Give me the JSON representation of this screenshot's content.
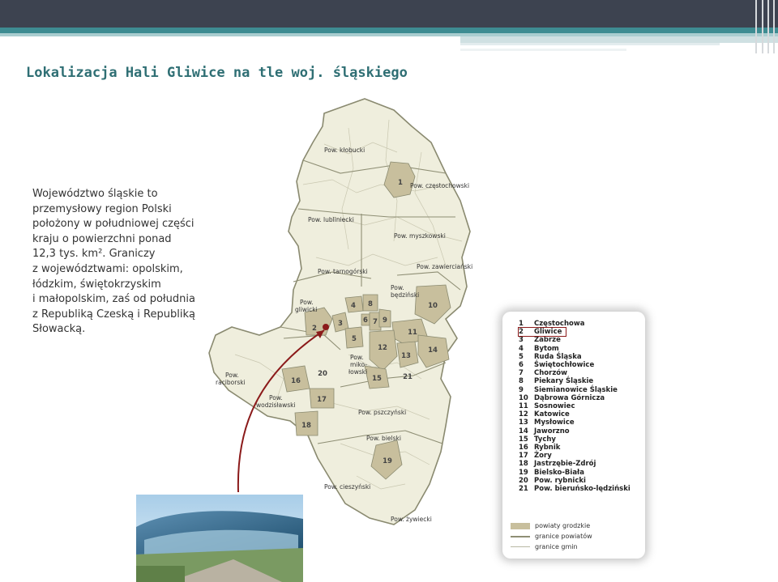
{
  "header": {
    "title": "Lokalizacja Hali Gliwice na tle woj. śląskiego"
  },
  "description_lines": [
    "Województwo śląskie to",
    "przemysłowy region Polski",
    "położony w południowej części",
    "kraju o powierzchni ponad",
    "12,3 tys. km². Graniczy",
    "z województwami: opolskim,",
    "łódzkim, świętokrzyskim",
    "i małopolskim, zaś od południa",
    "z Republiką Czeską i Republiką",
    "Słowacką."
  ],
  "map": {
    "powiat_labels": {
      "klobucki": "Pow. kłobucki",
      "czestochowski": "Pow. częstochowski",
      "lubliniecki": "Pow. lubliniecki",
      "myszkowski": "Pow. myszkowski",
      "zawiercianski": "Pow. zawierciański",
      "tarnogorski": "Pow. tarnogórski",
      "bedzinski_1": "Pow.",
      "bedzinski_2": "będziński",
      "gliwicki_1": "Pow.",
      "gliwicki_2": "gliwicki",
      "mikolowski_1": "Pow.",
      "mikolowski_2": "miko-",
      "mikolowski_3": "łowski",
      "raciborski_1": "Pow.",
      "raciborski_2": "raciborski",
      "wodzislawski_1": "Pow.",
      "wodzislawski_2": "wodzisławski",
      "pszczynski": "Pow. pszczyński",
      "bielski": "Pow. bielski",
      "cieszynski": "Pow. cieszyński",
      "zywiecki": "Pow. żywiecki"
    },
    "numbers": [
      "1",
      "2",
      "3",
      "4",
      "5",
      "6",
      "7",
      "8",
      "9",
      "10",
      "11",
      "12",
      "13",
      "14",
      "15",
      "16",
      "17",
      "18",
      "19",
      "20",
      "21"
    ]
  },
  "legend": {
    "items": [
      {
        "num": "1",
        "name": "Częstochowa"
      },
      {
        "num": "2",
        "name": "Gliwice"
      },
      {
        "num": "3",
        "name": "Zabrze"
      },
      {
        "num": "4",
        "name": "Bytom"
      },
      {
        "num": "5",
        "name": "Ruda Śląska"
      },
      {
        "num": "6",
        "name": "Świętochłowice"
      },
      {
        "num": "7",
        "name": "Chorzów"
      },
      {
        "num": "8",
        "name": "Piekary Śląskie"
      },
      {
        "num": "9",
        "name": "Siemianowice Śląskie"
      },
      {
        "num": "10",
        "name": "Dąbrowa Górnicza"
      },
      {
        "num": "11",
        "name": "Sosnowiec"
      },
      {
        "num": "12",
        "name": "Katowice"
      },
      {
        "num": "13",
        "name": "Mysłowice"
      },
      {
        "num": "14",
        "name": "Jaworzno"
      },
      {
        "num": "15",
        "name": "Tychy"
      },
      {
        "num": "16",
        "name": "Rybnik"
      },
      {
        "num": "17",
        "name": "Żory"
      },
      {
        "num": "18",
        "name": "Jastrzębie-Zdrój"
      },
      {
        "num": "19",
        "name": "Bielsko-Biała"
      },
      {
        "num": "20",
        "name": "Pow. rybnicki"
      },
      {
        "num": "21",
        "name": "Pow. bieruńsko-lędziński"
      }
    ],
    "keys": {
      "powiaty": "powiaty grodzkie",
      "granice_powiatow": "granice powiatów",
      "granice_gmin": "granice gmin"
    }
  },
  "colors": {
    "title": "#2f6f74",
    "map_fill": "#efeedd",
    "city_fill": "#c8bf9d",
    "arrow": "#8b1a1a"
  }
}
